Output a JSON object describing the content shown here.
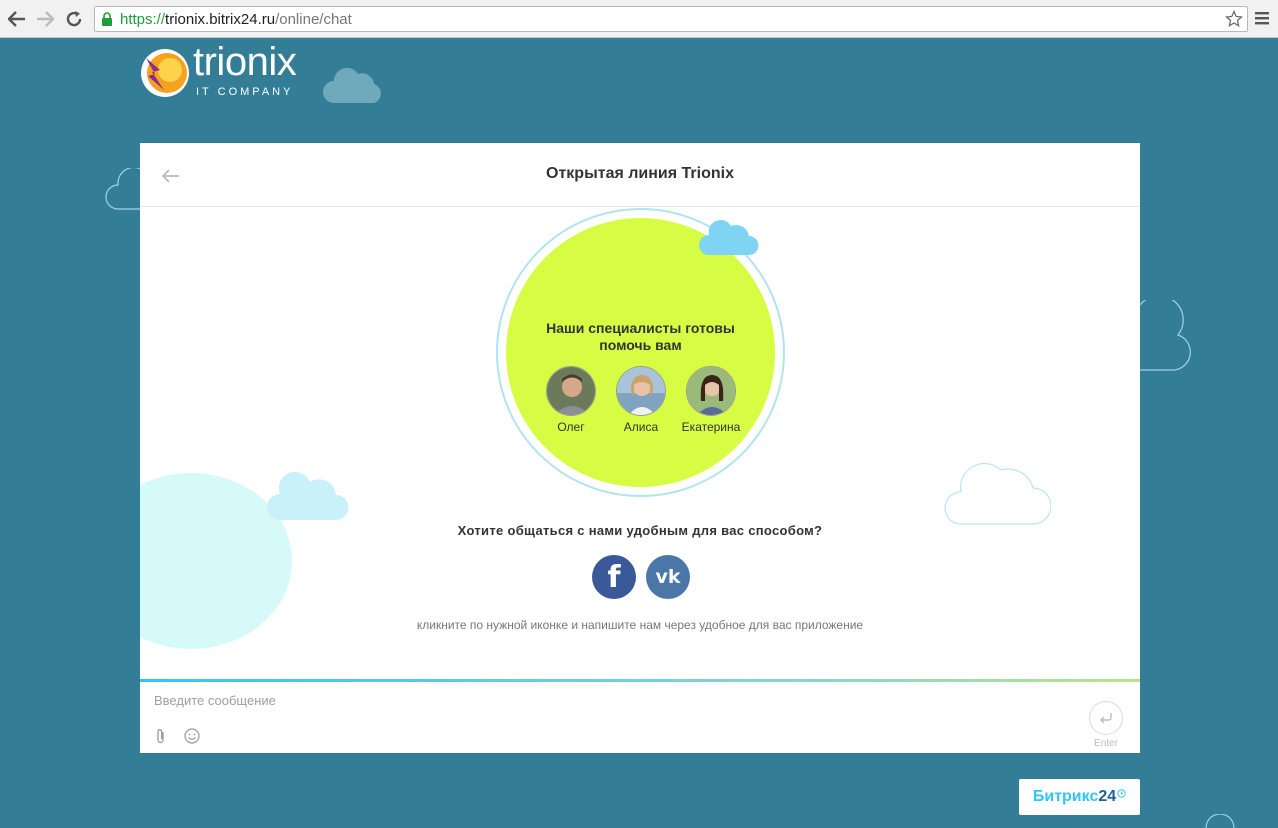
{
  "browser": {
    "url_scheme": "https://",
    "url_host": "trionix.bitrix24.ru",
    "url_path": "/online/chat"
  },
  "header": {
    "logo_word": "trionix",
    "logo_sub": "IT COMPANY"
  },
  "chat": {
    "title": "Открытая линия Trionix",
    "welcome": "Наши специалисты готовы помочь вам",
    "operators": [
      {
        "name": "Олег"
      },
      {
        "name": "Алиса"
      },
      {
        "name": "Екатерина"
      }
    ],
    "prompt": "Хотите общаться с нами удобным для вас способом?",
    "social": {
      "facebook_glyph": "f",
      "vk_glyph": "vk"
    },
    "hint": "кликните по нужной иконке и напишите нам через удобное для вас приложение",
    "input_placeholder": "Введите сообщение",
    "enter_label": "Enter"
  },
  "footer": {
    "brand_text": "Битрикс",
    "brand_num": "24"
  },
  "colors": {
    "background": "#347d96",
    "welcome_circle": "#d7fc44",
    "accent": "#2fc6f6",
    "facebook": "#3b5998",
    "vk": "#4a76a8"
  }
}
